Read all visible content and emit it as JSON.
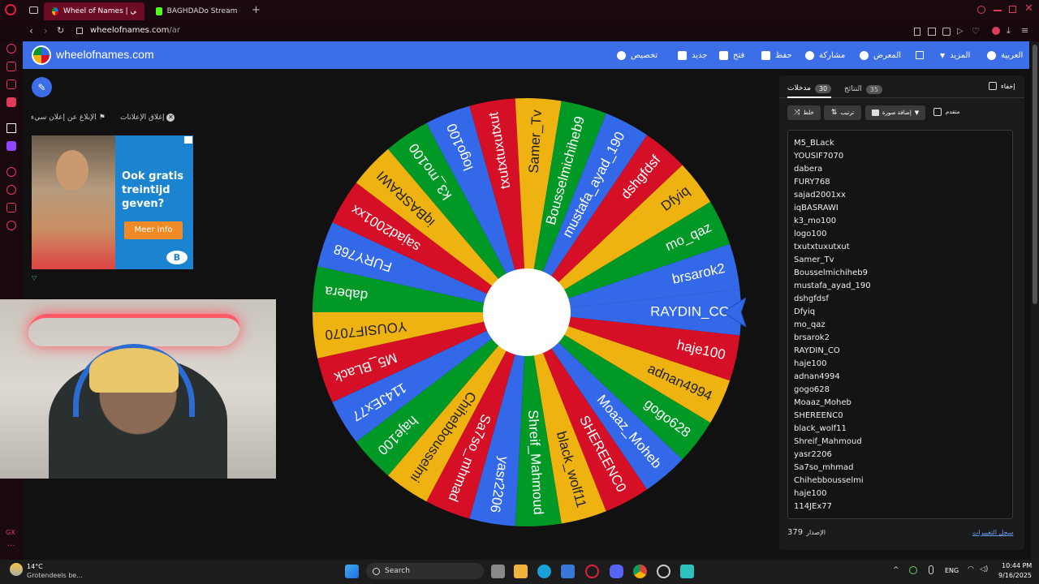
{
  "browser": {
    "tabs": [
      {
        "label": "Wheel of Names | عشوائي",
        "active": true
      },
      {
        "label": "BAGHDADo Stream - Watc",
        "active": false
      }
    ],
    "url_host": "wheelofnames.com",
    "url_path": "/ar",
    "new_tab": "+"
  },
  "site": {
    "title": "wheelofnames.com",
    "menu": {
      "customize": "تخصيص",
      "new": "جديد",
      "open": "فتح",
      "save": "حفظ",
      "share": "مشاركة",
      "gallery": "المعرض",
      "more": "المزيد",
      "language": "العربية"
    }
  },
  "ads": {
    "report": "الإبلاغ عن إعلان سيء",
    "close": "إغلاق الإعلانات",
    "banner": {
      "line1": "Ook gratis",
      "line2": "treintijd",
      "line3": "geven?",
      "cta": "Meer info",
      "brand": "B"
    }
  },
  "wheel": {
    "colors": [
      "#3369e8",
      "#d50f25",
      "#eeb211",
      "#009925"
    ],
    "pointer_color": "#3369e8",
    "slices": [
      "RAYDIN_CO",
      "haje100",
      "adnan4994",
      "gogo628",
      "Moaaz_Moheb",
      "SHEREENC0",
      "black_wolf11",
      "Shreif_Mahmoud",
      "yasr2206",
      "Sa7so_mhmad",
      "Chihebbousselmi",
      "haje100",
      "114JEx77",
      "M5_BLack",
      "YOUSIF7070",
      "dabera",
      "FURY768",
      "sajad2001xx",
      "iqBASRAWI",
      "k3_mo100",
      "logo100",
      "txutxtuxutxut",
      "Samer_Tv",
      "Bousselmichiheb9",
      "mustafa_ayad_190",
      "dshgfdsf",
      "Dfyiq",
      "mo_qaz",
      "brsarok2"
    ]
  },
  "panel": {
    "tab_entries": "مدخلات",
    "entries_count": "30",
    "tab_results": "النتائج",
    "results_count": "35",
    "hide": "إخفاء",
    "shuffle": "خلط",
    "sort": "ترتيب",
    "add_image": "إضافة صورة",
    "advanced": "متقدم",
    "entries": [
      "M5_BLack",
      "YOUSIF7070",
      "dabera",
      "FURY768",
      "sajad2001xx",
      "iqBASRAWI",
      "k3_mo100",
      "logo100",
      "txutxtuxutxut",
      "Samer_Tv",
      "Bousselmichiheb9",
      "mustafa_ayad_190",
      "dshgfdsf",
      "Dfyiq",
      "mo_qaz",
      "brsarok2",
      "RAYDIN_CO",
      "haje100",
      "adnan4994",
      "gogo628",
      "Moaaz_Moheb",
      "SHEREENC0",
      "black_wolf11",
      "Shreif_Mahmoud",
      "yasr2206",
      "Sa7so_mhmad",
      "Chihebbousselmi",
      "haje100",
      "114JEx77"
    ],
    "version_label": "الإصدار",
    "version_number": "379",
    "changelog": "سجل التغييرات"
  },
  "taskbar": {
    "weather_temp": "14°C",
    "weather_desc": "Grotendeels be...",
    "search": "Search",
    "lang": "ENG",
    "time": "10:44 PM",
    "date": "9/16/2025"
  }
}
